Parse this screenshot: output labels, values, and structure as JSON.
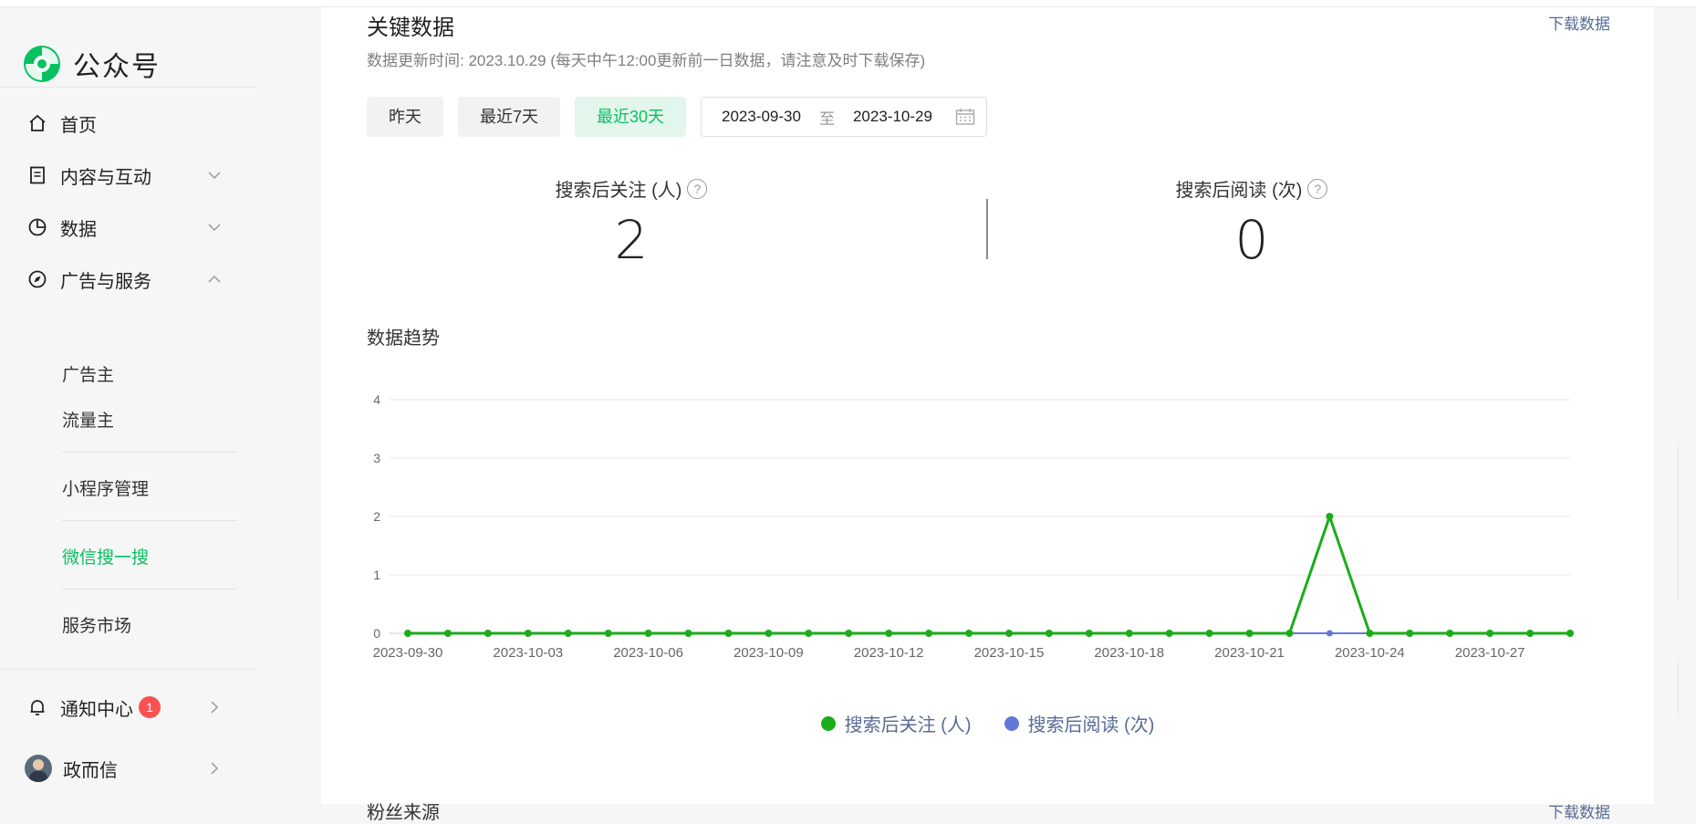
{
  "app": {
    "name": "公众号"
  },
  "sidebar": {
    "home": "首页",
    "content": "内容与互动",
    "data": "数据",
    "ads": "广告与服务",
    "ads_sub": [
      "广告主",
      "流量主"
    ],
    "miniprogram": "小程序管理",
    "search": "微信搜一搜",
    "market": "服务市场",
    "notify": "通知中心",
    "notify_count": "1",
    "account": "政而信"
  },
  "main": {
    "title": "关键数据",
    "download": "下载数据",
    "update_note": "数据更新时间: 2023.10.29  (每天中午12:00更新前一日数据，请注意及时下载保存)",
    "filters": [
      "昨天",
      "最近7天",
      "最近30天"
    ],
    "active_filter": "最近30天",
    "date_start": "2023-09-30",
    "date_to": "至",
    "date_end": "2023-10-29",
    "kpis": [
      {
        "label": "搜索后关注 (人)",
        "value": "2"
      },
      {
        "label": "搜索后阅读 (次)",
        "value": "0"
      }
    ],
    "trend_title": "数据趋势",
    "next_title": "粉丝来源",
    "next_link": "下载数据"
  },
  "colors": {
    "green": "#07c160",
    "series_follow": "#1aad19",
    "series_read": "#6478d9",
    "link": "#576b95"
  },
  "chart_data": {
    "type": "line",
    "x": [
      "2023-09-30",
      "2023-10-01",
      "2023-10-02",
      "2023-10-03",
      "2023-10-04",
      "2023-10-05",
      "2023-10-06",
      "2023-10-07",
      "2023-10-08",
      "2023-10-09",
      "2023-10-10",
      "2023-10-11",
      "2023-10-12",
      "2023-10-13",
      "2023-10-14",
      "2023-10-15",
      "2023-10-16",
      "2023-10-17",
      "2023-10-18",
      "2023-10-19",
      "2023-10-20",
      "2023-10-21",
      "2023-10-22",
      "2023-10-23",
      "2023-10-24",
      "2023-10-25",
      "2023-10-26",
      "2023-10-27",
      "2023-10-28",
      "2023-10-29"
    ],
    "xticks": [
      "2023-09-30",
      "2023-10-03",
      "2023-10-06",
      "2023-10-09",
      "2023-10-12",
      "2023-10-15",
      "2023-10-18",
      "2023-10-21",
      "2023-10-24",
      "2023-10-27"
    ],
    "yticks": [
      "0",
      "1",
      "2",
      "3",
      "4"
    ],
    "ylim": [
      0,
      4
    ],
    "grid": true,
    "legend": "bottom-center",
    "series": [
      {
        "name": "搜索后关注 (人)",
        "values": [
          0,
          0,
          0,
          0,
          0,
          0,
          0,
          0,
          0,
          0,
          0,
          0,
          0,
          0,
          0,
          0,
          0,
          0,
          0,
          0,
          0,
          0,
          0,
          2,
          0,
          0,
          0,
          0,
          0,
          0
        ]
      },
      {
        "name": "搜索后阅读 (次)",
        "values": [
          0,
          0,
          0,
          0,
          0,
          0,
          0,
          0,
          0,
          0,
          0,
          0,
          0,
          0,
          0,
          0,
          0,
          0,
          0,
          0,
          0,
          0,
          0,
          0,
          0,
          0,
          0,
          0,
          0,
          0
        ]
      }
    ]
  }
}
